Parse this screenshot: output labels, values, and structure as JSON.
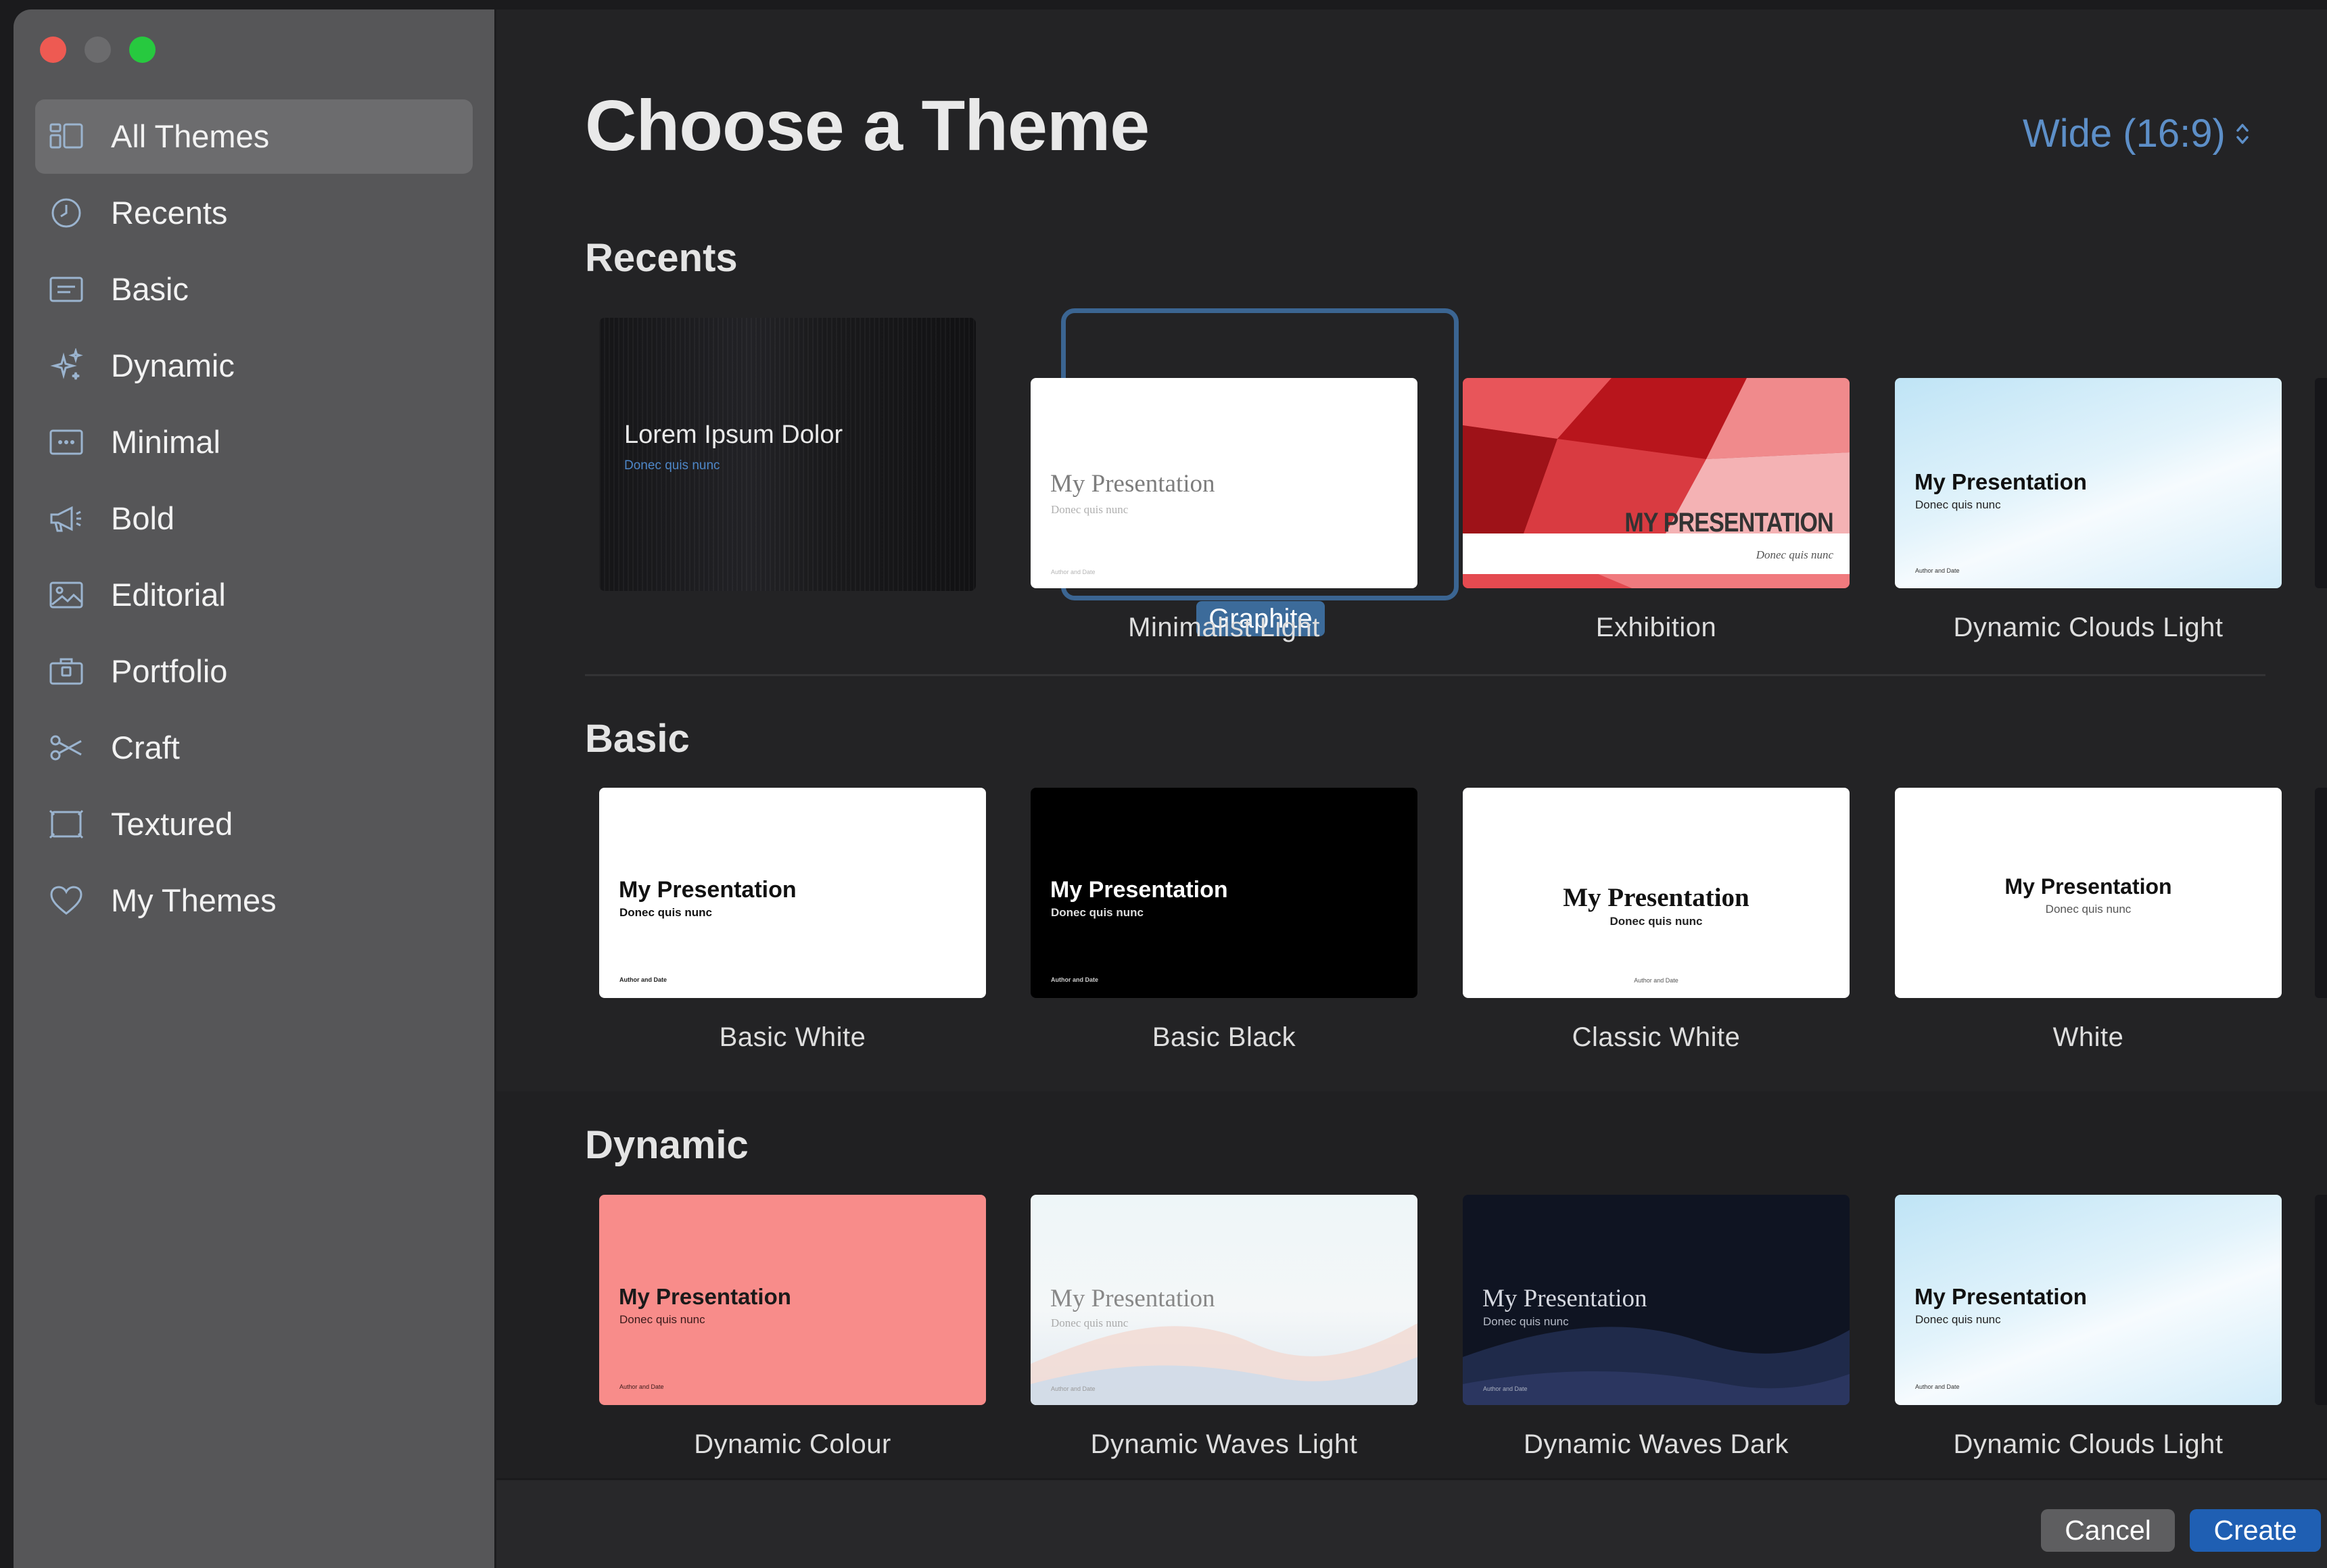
{
  "sidebar": {
    "items": [
      {
        "label": "All Themes",
        "icon": "all-themes-icon",
        "active": true
      },
      {
        "label": "Recents",
        "icon": "clock-icon"
      },
      {
        "label": "Basic",
        "icon": "basic-slide-icon"
      },
      {
        "label": "Dynamic",
        "icon": "sparkles-icon"
      },
      {
        "label": "Minimal",
        "icon": "ellipsis-rectangle-icon"
      },
      {
        "label": "Bold",
        "icon": "megaphone-icon"
      },
      {
        "label": "Editorial",
        "icon": "photo-icon"
      },
      {
        "label": "Portfolio",
        "icon": "portfolio-icon"
      },
      {
        "label": "Craft",
        "icon": "scissors-icon"
      },
      {
        "label": "Textured",
        "icon": "textured-frame-icon"
      },
      {
        "label": "My Themes",
        "icon": "heart-icon"
      }
    ]
  },
  "header": {
    "title": "Choose a Theme",
    "size_select": "Wide (16:9)"
  },
  "sections": [
    {
      "title": "Recents",
      "themes": [
        {
          "name": "Graphite",
          "selected": true,
          "thumb_title": "Lorem Ipsum Dolor",
          "thumb_sub": "Donec quis nunc"
        },
        {
          "name": "Minimalist Light",
          "thumb_title": "My Presentation",
          "thumb_sub": "Donec quis nunc",
          "thumb_foot": "Author and Date"
        },
        {
          "name": "Exhibition",
          "thumb_title": "MY PRESENTATION",
          "thumb_sub": "Donec quis nunc"
        },
        {
          "name": "Dynamic Clouds Light",
          "thumb_title": "My Presentation",
          "thumb_sub": "Donec quis nunc",
          "thumb_foot": "Author and Date"
        }
      ]
    },
    {
      "title": "Basic",
      "themes": [
        {
          "name": "Basic White",
          "thumb_title": "My Presentation",
          "thumb_sub": "Donec quis nunc",
          "thumb_foot": "Author and Date"
        },
        {
          "name": "Basic Black",
          "thumb_title": "My Presentation",
          "thumb_sub": "Donec quis nunc",
          "thumb_foot": "Author and Date"
        },
        {
          "name": "Classic White",
          "thumb_title": "My Presentation",
          "thumb_sub": "Donec quis nunc",
          "thumb_foot": "Author and Date"
        },
        {
          "name": "White",
          "thumb_title": "My Presentation",
          "thumb_sub": "Donec quis nunc"
        }
      ]
    },
    {
      "title": "Dynamic",
      "themes": [
        {
          "name": "Dynamic Colour",
          "thumb_title": "My Presentation",
          "thumb_sub": "Donec quis nunc",
          "thumb_foot": "Author and Date"
        },
        {
          "name": "Dynamic Waves Light",
          "thumb_title": "My Presentation",
          "thumb_sub": "Donec quis nunc",
          "thumb_foot": "Author and Date"
        },
        {
          "name": "Dynamic Waves Dark",
          "thumb_title": "My Presentation",
          "thumb_sub": "Donec quis nunc",
          "thumb_foot": "Author and Date"
        },
        {
          "name": "Dynamic Clouds Light",
          "thumb_title": "My Presentation",
          "thumb_sub": "Donec quis nunc",
          "thumb_foot": "Author and Date"
        }
      ]
    }
  ],
  "footer": {
    "cancel_label": "Cancel",
    "create_label": "Create"
  },
  "colors": {
    "accent": "#3c6b9a",
    "create_button": "#1f5fb3",
    "size_select_text": "#5d8fc8",
    "sidebar_bg": "#565658",
    "main_bg": "#232325"
  }
}
